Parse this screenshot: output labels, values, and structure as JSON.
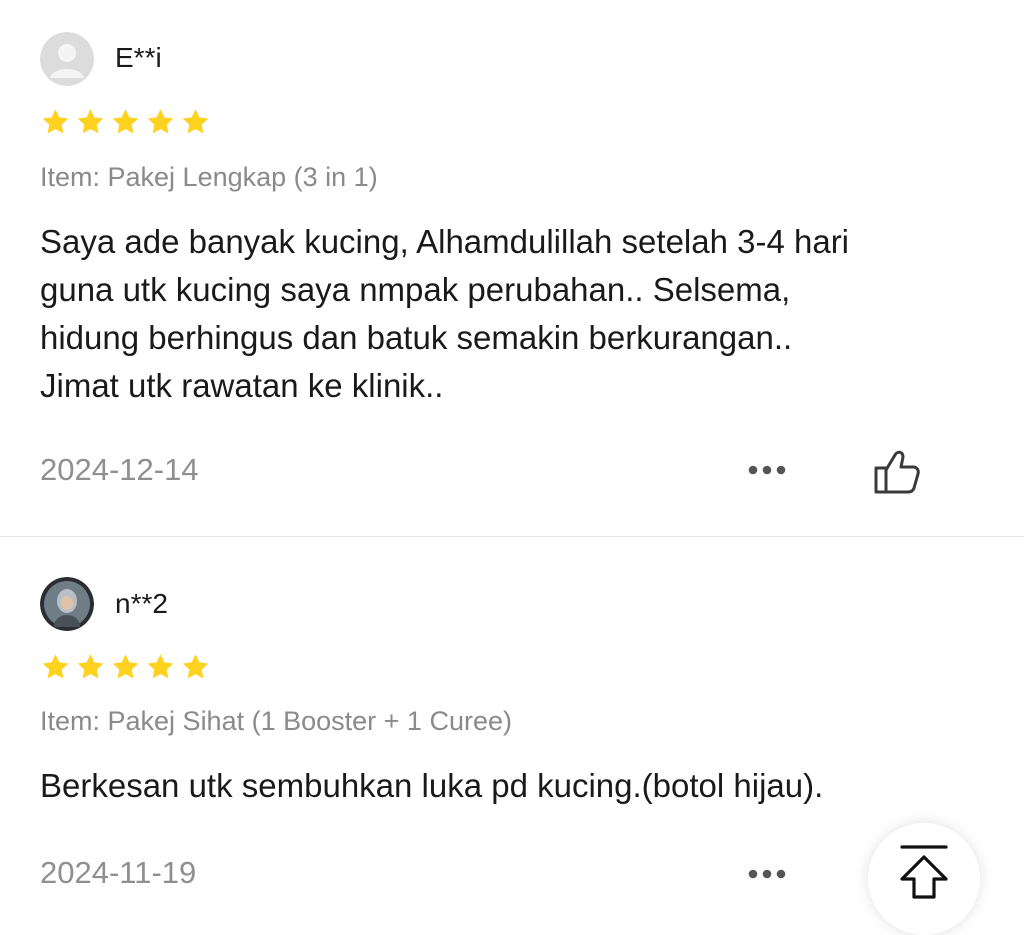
{
  "colors": {
    "star": "#FFD21F",
    "text": "#1a1a1a",
    "muted": "#8a8a8a",
    "divider": "#e6e6e6"
  },
  "reviews": [
    {
      "username": "E**i",
      "avatar": "default-avatar-icon",
      "rating": 5,
      "item": "Item: Pakej Lengkap (3 in 1)",
      "lines": [
        "Saya ade banyak kucing, Alhamdulillah setelah 3-4 hari",
        "guna utk kucing saya nmpak perubahan.. Selsema,",
        "hidung berhingus dan batuk semakin berkurangan..",
        "Jimat utk rawatan ke klinik.."
      ],
      "date": "2024-12-14"
    },
    {
      "username": "n**2",
      "avatar": "user-photo-avatar",
      "rating": 5,
      "item": "Item: Pakej Sihat (1 Booster + 1 Curee)",
      "lines": [
        "Berkesan utk sembuhkan luka pd kucing.(botol hijau)."
      ],
      "date": "2024-11-19"
    }
  ],
  "icons": {
    "more": "more-dots-icon",
    "like": "thumbs-up-icon",
    "scroll_top": "arrow-up-to-top-icon"
  }
}
